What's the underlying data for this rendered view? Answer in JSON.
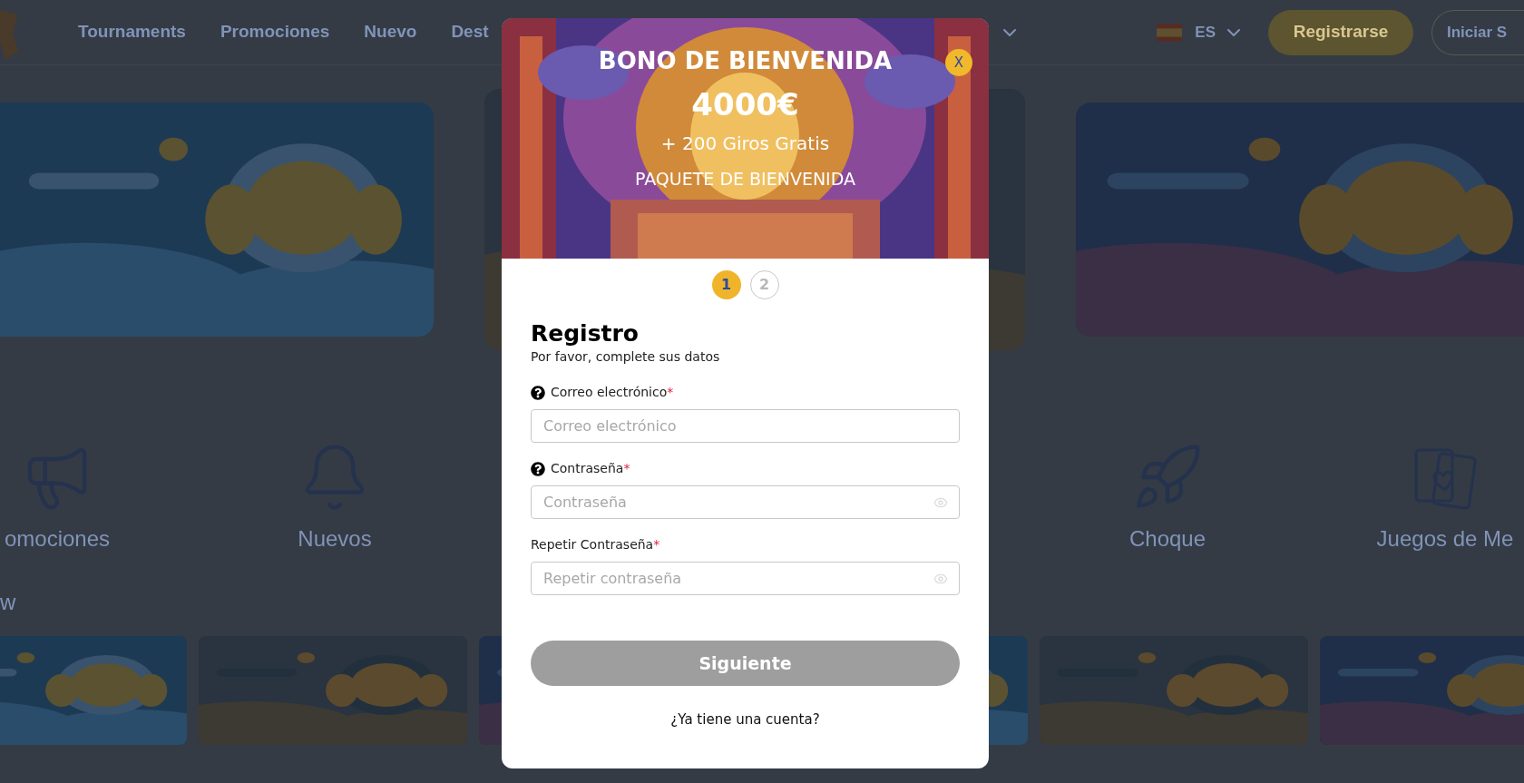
{
  "nav": {
    "items": [
      "Tournaments",
      "Promociones",
      "Nuevo",
      "Dest"
    ],
    "language": "ES",
    "register": "Registrarse",
    "login": "Iniciar S"
  },
  "categories": [
    {
      "label": "omociones"
    },
    {
      "label": "Nuevos"
    },
    {
      "label": "Choque"
    },
    {
      "label": "Juegos de Me"
    }
  ],
  "section_title": "w",
  "modal": {
    "close": "X",
    "bonus_title": "BONO DE BIENVENIDA",
    "amount": "4000€",
    "spins": "+ 200 Giros Gratis",
    "package": "PAQUETE DE BIENVENIDA",
    "steps": [
      {
        "label": "1",
        "selected": true
      },
      {
        "label": "2",
        "selected": false
      }
    ],
    "title": "Registro",
    "subtitle": "Por favor, complete sus datos",
    "fields": [
      {
        "label": "Correo electrónico",
        "required_mark": "*",
        "help": true,
        "placeholder": "Correo electrónico",
        "password": false
      },
      {
        "label": "Contraseña",
        "required_mark": "*",
        "help": true,
        "placeholder": "Contraseña",
        "password": true
      },
      {
        "label": "Repetir Contraseña",
        "required_mark": "*",
        "help": false,
        "placeholder": "Repetir contraseña",
        "password": true
      }
    ],
    "submit": {
      "label": "Siguiente",
      "disabled": true
    },
    "login_prompt": "¿Ya tiene una cuenta?"
  }
}
